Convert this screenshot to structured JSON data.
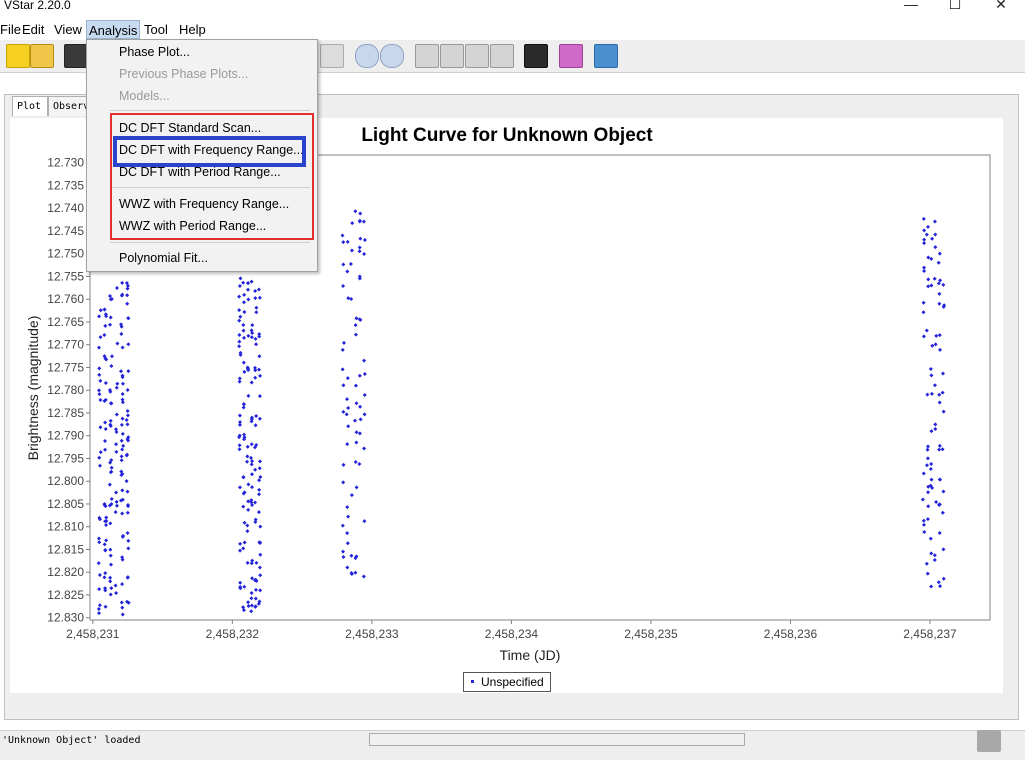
{
  "window": {
    "title": "VStar 2.20.0",
    "minimize": "—",
    "maximize": "☐",
    "close": "✕"
  },
  "menubar": {
    "items": [
      "File",
      "Edit",
      "View",
      "Analysis",
      "Tool",
      "Help"
    ]
  },
  "toolbar": {
    "icons": [
      "new-star-icon",
      "open-star-icon",
      "save-icon",
      "blank",
      "blank",
      "blank",
      "blank",
      "blank",
      "plot-icon",
      "zoom-in-icon",
      "zoom-out-icon",
      "arrow-left-icon",
      "arrow-right-icon",
      "arrow-up-icon",
      "arrow-down-icon",
      "binoculars-icon",
      "plugin-icon",
      "info-icon"
    ]
  },
  "tabs": [
    "Plot",
    "Observ"
  ],
  "analysis_menu": {
    "items": [
      {
        "label": "Phase Plot...",
        "enabled": true
      },
      {
        "label": "Previous Phase Plots...",
        "enabled": false
      },
      {
        "label": "Models...",
        "enabled": false
      },
      {
        "label": "DC DFT Standard Scan...",
        "enabled": true
      },
      {
        "label": "DC DFT with Frequency Range...",
        "enabled": true
      },
      {
        "label": "DC DFT with Period Range...",
        "enabled": true
      },
      {
        "label": "WWZ with Frequency Range...",
        "enabled": true
      },
      {
        "label": "WWZ with Period Range...",
        "enabled": true
      },
      {
        "label": "Polynomial Fit...",
        "enabled": true
      }
    ]
  },
  "chart_data": {
    "type": "scatter",
    "title": "Light Curve for Unknown Object",
    "xlabel": "Time (JD)",
    "ylabel": "Brightness (magnitude)",
    "xlim": [
      2458230.98,
      2458237.43
    ],
    "ylim": [
      12.8305,
      12.7283
    ],
    "y_inverted": true,
    "grid": false,
    "legend_position": "bottom-center",
    "x_ticks": [
      "2,458,231",
      "2,458,232",
      "2,458,233",
      "2,458,234",
      "2,458,235",
      "2,458,236",
      "2,458,237"
    ],
    "x_tick_values": [
      2458231,
      2458232,
      2458233,
      2458234,
      2458235,
      2458236,
      2458237
    ],
    "y_ticks": [
      "12.730",
      "12.735",
      "12.740",
      "12.745",
      "12.750",
      "12.755",
      "12.760",
      "12.765",
      "12.770",
      "12.775",
      "12.780",
      "12.785",
      "12.790",
      "12.795",
      "12.800",
      "12.805",
      "12.810",
      "12.815",
      "12.820",
      "12.825",
      "12.830"
    ],
    "series": [
      {
        "name": "Unspecified",
        "color": "#2424d8",
        "clusters": [
          {
            "x_min": 2458231.03,
            "x_max": 2458231.27,
            "y_min": 12.756,
            "y_max": 12.8295,
            "count": 170
          },
          {
            "x_min": 2458232.04,
            "x_max": 2458232.21,
            "y_min": 12.7545,
            "y_max": 12.83,
            "count": 150
          },
          {
            "x_min": 2458232.78,
            "x_max": 2458232.96,
            "y_min": 12.7405,
            "y_max": 12.8235,
            "count": 75
          },
          {
            "x_min": 2458236.94,
            "x_max": 2458237.11,
            "y_min": 12.741,
            "y_max": 12.8235,
            "count": 90
          }
        ]
      }
    ]
  },
  "status": {
    "text": "'Unknown Object' loaded"
  }
}
